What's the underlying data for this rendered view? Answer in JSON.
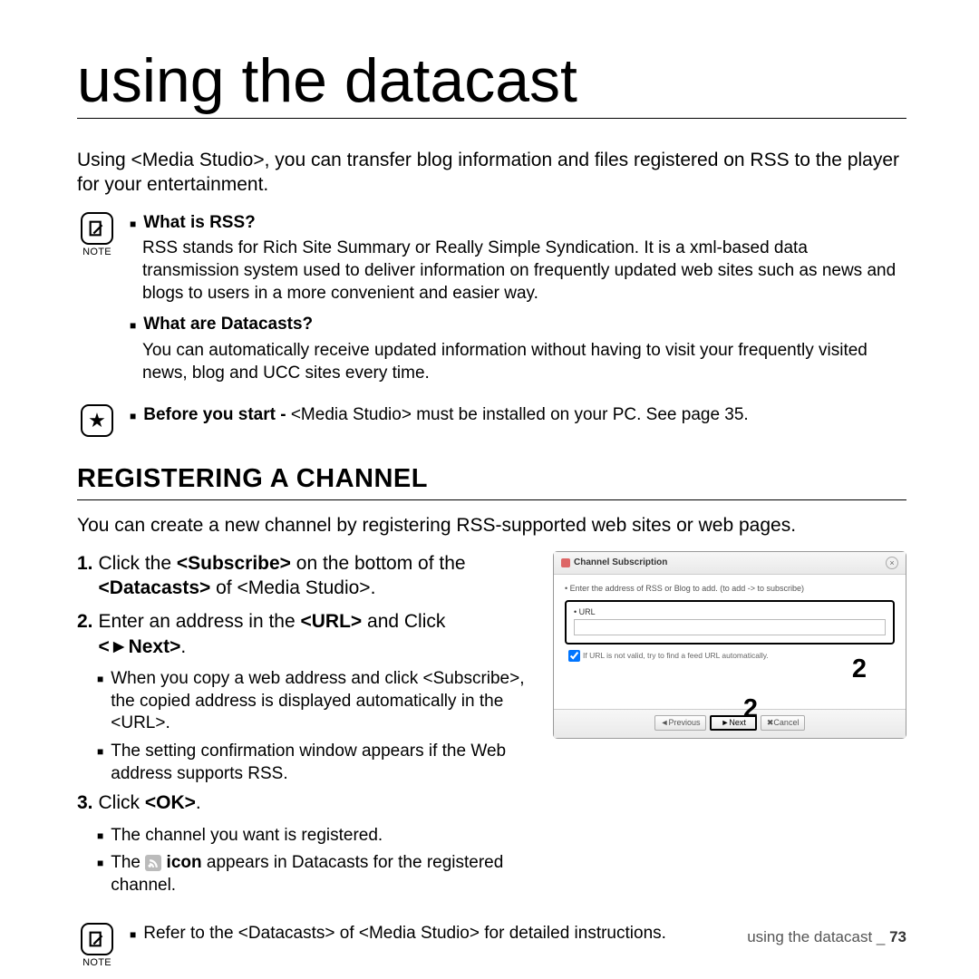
{
  "title": "using the datacast",
  "intro": "Using <Media Studio>, you can transfer blog information and files registered on RSS to the player for your entertainment.",
  "note_label": "NOTE",
  "note1_heading": "What is RSS?",
  "note1_body": "RSS stands for Rich Site Summary or Really Simple Syndication. It is a xml-based data transmission system used to deliver information on frequently updated web sites such as news and blogs to users in a more convenient and easier way.",
  "note2_heading": "What are Datacasts?",
  "note2_body": "You can automatically receive updated information without having to visit your frequently visited news, blog and UCC sites every time.",
  "star_prefix": "Before you start -",
  "star_body": " <Media Studio> must be installed on your PC. See page 35.",
  "section_heading": "REGISTERING A CHANNEL",
  "section_intro": "You can create a new channel by registering RSS-supported web sites or web pages.",
  "steps": {
    "s1_num": "1.",
    "s1_a": "Click the ",
    "s1_b": "<Subscribe>",
    "s1_c": " on the bottom of the ",
    "s1_d": "<Datacasts>",
    "s1_e": " of <Media Studio>.",
    "s2_num": "2.",
    "s2_a": "Enter an address in the ",
    "s2_b": "<URL>",
    "s2_c": " and Click ",
    "s2_d": "<►Next>",
    "s2_e": ".",
    "s2_sub1": "When you copy a web address and click <Subscribe>, the copied address is displayed automatically in the <URL>.",
    "s2_sub2": "The setting confirmation window appears if the Web address supports RSS.",
    "s3_num": "3.",
    "s3_a": "Click ",
    "s3_b": "<OK>",
    "s3_c": ".",
    "s3_sub1": "The channel you want is registered.",
    "s3_sub2_a": "The ",
    "s3_sub2_b": " icon",
    "s3_sub2_c": " appears in Datacasts for the registered channel."
  },
  "bottom_note": "Refer to the <Datacasts> of <Media Studio> for detailed instructions.",
  "dialog": {
    "title": "Channel Subscription",
    "hint": "• Enter the address of RSS or Blog to add. (to add -> to subscribe)",
    "url_label": "• URL",
    "checkbox": "If URL is not valid, try to find a feed URL automatically.",
    "btn_prev": "◄Previous",
    "btn_next": "►Next",
    "btn_cancel": "✖Cancel"
  },
  "overlay_a": "2",
  "overlay_b": "2",
  "footer_text": "using the datacast _ ",
  "footer_page": "73"
}
